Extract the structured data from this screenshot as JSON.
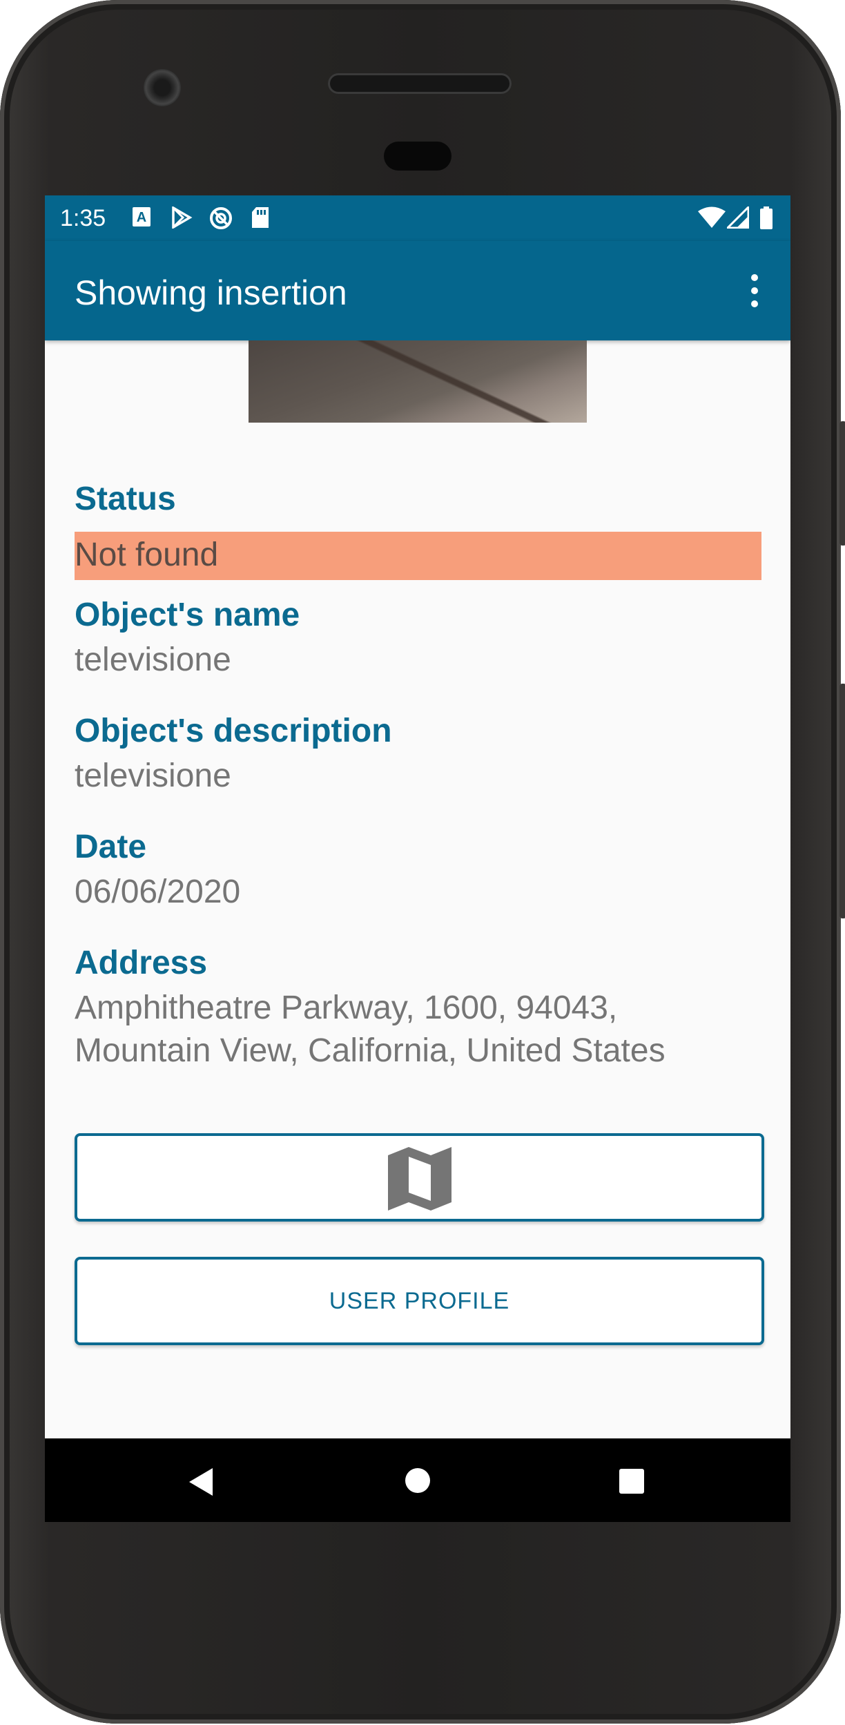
{
  "status_bar": {
    "time": "1:35",
    "left_icons": [
      "font-icon",
      "play-store-icon",
      "at-sign-icon",
      "sd-card-icon"
    ],
    "right_icons": [
      "wifi-icon",
      "signal-icon",
      "battery-icon"
    ]
  },
  "app_bar": {
    "title": "Showing insertion",
    "menu_icon": "more-vert-icon"
  },
  "details": {
    "status_label": "Status",
    "status_value": "Not found",
    "name_label": "Object's name",
    "name_value": "televisione",
    "description_label": "Object's description",
    "description_value": "televisione",
    "date_label": "Date",
    "date_value": "06/06/2020",
    "address_label": "Address",
    "address_line1": "Amphitheatre Parkway, 1600, 94043,",
    "address_line2": "Mountain View, California, United States"
  },
  "buttons": {
    "map_icon": "map-icon",
    "user_profile_label": "USER PROFILE"
  },
  "colors": {
    "primary": "#05668d",
    "accent_text": "#0b6a90",
    "status_highlight": "#f79e7b"
  },
  "nav_bar": {
    "icons": [
      "back-icon",
      "home-icon",
      "recents-icon"
    ]
  }
}
